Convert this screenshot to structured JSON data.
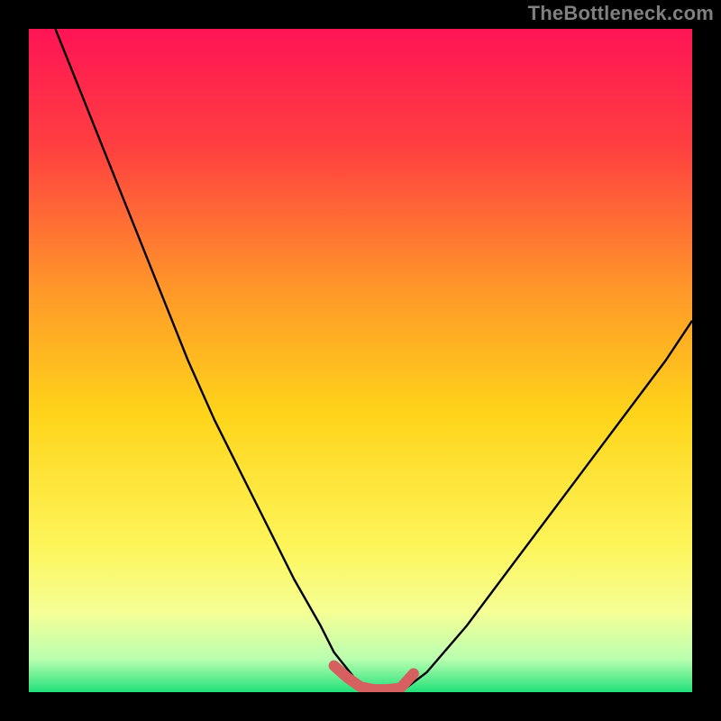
{
  "watermark": {
    "text": "TheBottleneck.com"
  },
  "chart_data": {
    "type": "line",
    "title": "",
    "xlabel": "",
    "ylabel": "",
    "xlim": [
      0,
      100
    ],
    "ylim": [
      0,
      100
    ],
    "grid": false,
    "background_gradient": {
      "type": "vertical",
      "stops": [
        {
          "pos": 0.0,
          "color": "#ff1455"
        },
        {
          "pos": 0.18,
          "color": "#ff4040"
        },
        {
          "pos": 0.4,
          "color": "#ff9a28"
        },
        {
          "pos": 0.58,
          "color": "#ffd41a"
        },
        {
          "pos": 0.78,
          "color": "#fdf55a"
        },
        {
          "pos": 0.88,
          "color": "#f5ff96"
        },
        {
          "pos": 0.95,
          "color": "#baffb0"
        },
        {
          "pos": 1.0,
          "color": "#22e07a"
        }
      ]
    },
    "series": [
      {
        "name": "bottleneck-curve",
        "color": "#000000",
        "x": [
          4,
          8,
          12,
          16,
          20,
          24,
          28,
          32,
          36,
          40,
          44,
          46,
          50,
          54,
          56,
          60,
          66,
          72,
          78,
          84,
          90,
          96,
          100
        ],
        "y": [
          100,
          90,
          80,
          70,
          60,
          50,
          41,
          33,
          25,
          17,
          10,
          6,
          1,
          0,
          0,
          3,
          10,
          18,
          26,
          34,
          42,
          50,
          56
        ]
      },
      {
        "name": "optimal-region-marker",
        "color": "#d66060",
        "thick": true,
        "x": [
          46,
          48,
          50,
          52,
          54,
          56,
          58
        ],
        "y": [
          4,
          2.2,
          0.8,
          0.4,
          0.4,
          0.6,
          2.8
        ]
      }
    ]
  }
}
